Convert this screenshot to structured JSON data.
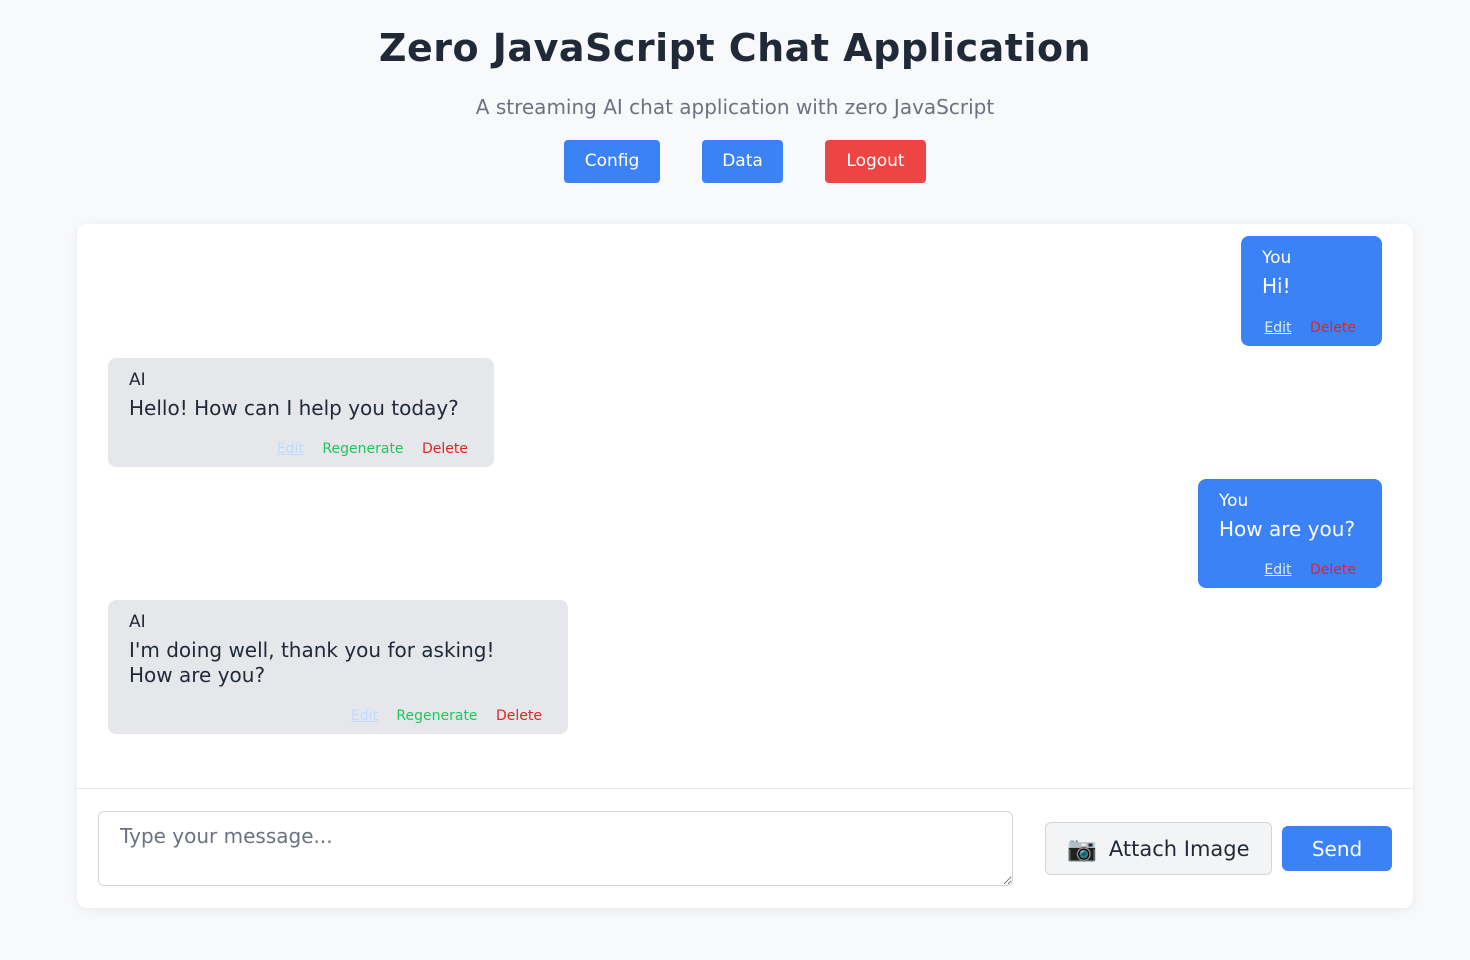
{
  "header": {
    "title": "Zero JavaScript Chat Application",
    "subtitle": "A streaming AI chat application with zero JavaScript"
  },
  "nav": {
    "config_label": "Config",
    "data_label": "Data",
    "logout_label": "Logout"
  },
  "messages": [
    {
      "sender": "You",
      "text": "Hi!",
      "edit": "Edit",
      "delete": "Delete"
    },
    {
      "sender": "AI",
      "text": "Hello! How can I help you today?",
      "edit": "Edit",
      "regenerate": "Regenerate",
      "delete": "Delete"
    },
    {
      "sender": "You",
      "text": "How are you?",
      "edit": "Edit",
      "delete": "Delete"
    },
    {
      "sender": "AI",
      "text": "I'm doing well, thank you for asking! How are you?",
      "edit": "Edit",
      "regenerate": "Regenerate",
      "delete": "Delete"
    }
  ],
  "composer": {
    "placeholder": "Type your message...",
    "value": "",
    "attach_icon": "camera-icon",
    "attach_glyph": "📷",
    "attach_label": "Attach Image",
    "send_label": "Send"
  },
  "colors": {
    "primary": "#3b82f6",
    "danger": "#ef4444",
    "regenerate": "#22c55e",
    "ai_bubble": "#e5e7eb"
  }
}
